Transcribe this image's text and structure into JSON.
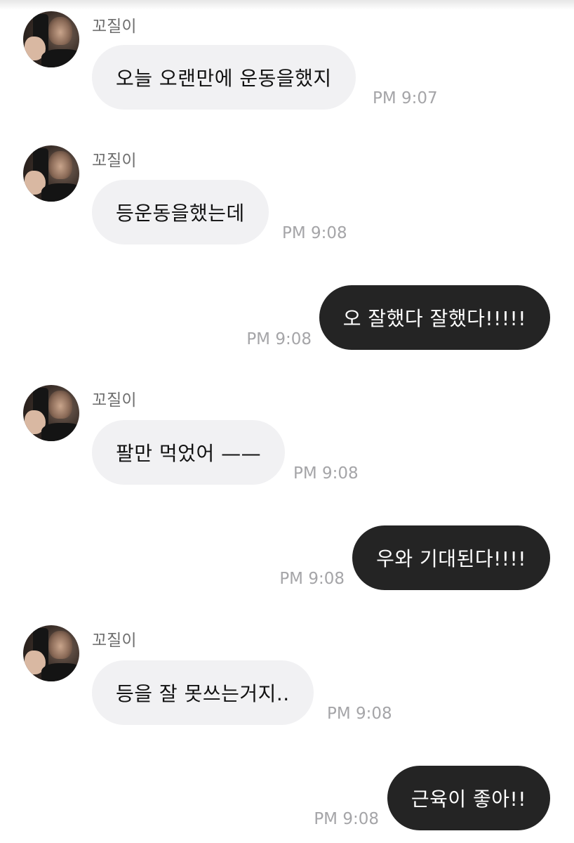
{
  "messages": [
    {
      "sender": "꼬질이",
      "text": "오늘 오랜만에 운동을했지",
      "time": "PM 9:07",
      "direction": "incoming"
    },
    {
      "sender": "꼬질이",
      "text": "등운동을했는데",
      "time": "PM 9:08",
      "direction": "incoming"
    },
    {
      "text": "오 잘했다 잘했다!!!!!",
      "time": "PM 9:08",
      "direction": "outgoing"
    },
    {
      "sender": "꼬질이",
      "text": "팔만 먹었어 ——",
      "time": "PM 9:08",
      "direction": "incoming"
    },
    {
      "text": "우와 기대된다!!!!",
      "time": "PM 9:08",
      "direction": "outgoing"
    },
    {
      "sender": "꼬질이",
      "text": "등을 잘 못쓰는거지..",
      "time": "PM 9:08",
      "direction": "incoming"
    },
    {
      "text": "근육이 좋아!!",
      "time": "PM 9:08",
      "direction": "outgoing"
    }
  ],
  "colors": {
    "incoming_bubble": "#f1f1f3",
    "outgoing_bubble": "#242424",
    "timestamp": "#a5a5a8",
    "sender_name": "#6e6e6e"
  }
}
